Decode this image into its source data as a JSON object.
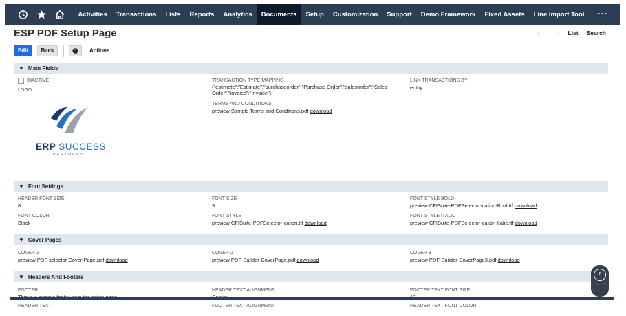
{
  "nav": {
    "icons": [
      "history-icon",
      "star-icon",
      "home-icon"
    ],
    "items": [
      "Activities",
      "Transactions",
      "Lists",
      "Reports",
      "Analytics",
      "Documents",
      "Setup",
      "Customization",
      "Support",
      "Demo Framework",
      "Fixed Assets",
      "Line Import Tool"
    ],
    "active": "Documents",
    "more": "···"
  },
  "page": {
    "title": "ESP PDF Setup Page",
    "back_arrow": "←",
    "forward_arrow": "→",
    "list_link": "List",
    "search_link": "Search"
  },
  "actions": {
    "edit": "Edit",
    "back": "Back",
    "print_icon": "🖶",
    "more": "Actions"
  },
  "sections": {
    "main": "Main Fields",
    "font": "Font Settings",
    "cover": "Cover Pages",
    "headers": "Headers And Footers"
  },
  "main_fields": {
    "inactive_label": "INACTIVE",
    "logo_label": "LOGO",
    "logo_brand_1": "ERP",
    "logo_brand_2": "SUCCESS",
    "logo_sub": "PARTNERS",
    "mapping_label": "TRANSACTION TYPE MAPPING",
    "mapping_value": "{\"estimate\":\"Estimate\",\"purchaseorder\":\"Purchase Order\",\"salesorder\":\"Sales Order\",\"invoice\":\"Invoice\"}",
    "link_label": "LINK TRANSACTIONS BY",
    "link_value": "entity",
    "terms_label": "TERMS AND CONDITIONS",
    "terms_value": "preview Sample Terms and Conditions.pdf",
    "terms_download": "download"
  },
  "font_settings": {
    "header_size_label": "HEADER FONT SIZE",
    "header_size_value": "8",
    "size_label": "FONT SIZE",
    "size_value": "9",
    "bold_label": "FONT STYLE BOLD",
    "bold_value": "preview CFISuite-PDFSelector-calibri-Bold.ttf",
    "bold_download": "download",
    "color_label": "FONT COLOR",
    "color_value": "Black",
    "style_label": "FONT STYLE",
    "style_value": "preview CFISuite-PDFSelector-calibri.ttf",
    "style_download": "download",
    "italic_label": "FONT STYLE ITALIC",
    "italic_value": "preview CFISuite-PDFSelector-calibri-Italic.ttf",
    "italic_download": "download"
  },
  "cover_pages": {
    "c1_label": "COVER 1",
    "c1_value": "preview PDF selector Cover Page.pdf",
    "c1_download": "download",
    "c2_label": "COVER 2",
    "c2_value": "preview PDF-Builder-CoverPage.pdf",
    "c2_download": "download",
    "c3_label": "COVER 3",
    "c3_value": "preview PDF-Builder-CoverPage3.pdf",
    "c3_download": "download"
  },
  "headers_footers": {
    "footer_label": "FOOTER",
    "footer_value": "This is a sample footer from the setup page",
    "hta_label": "HEADER TEXT ALIGNMENT",
    "hta_value": "Center",
    "ffs_label": "FOOTER TEXT FONT SIZE",
    "ffs_value": "12",
    "ht_label": "HEADER TEXT",
    "fta_label": "FOOTER TEXT ALIGNMENT",
    "hfc_label": "HEADER TEXT FONT COLOR"
  },
  "widget": {
    "info_glyph": "i",
    "dots": "⋮⋮⋮"
  },
  "colors": {
    "nav_bg": "#2b3e53",
    "nav_active": "#0e1a28",
    "edit_button": "#1b6ee4",
    "section_bg": "#e0e6ee",
    "logo_navy": "#1e3a6e",
    "logo_blue": "#1e73c9"
  }
}
